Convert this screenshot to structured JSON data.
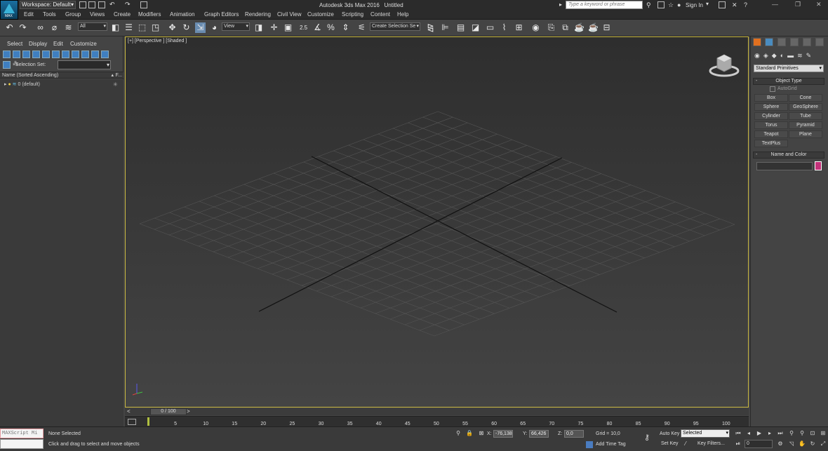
{
  "app": {
    "title": "Autodesk 3ds Max 2016",
    "doc": "Untitled",
    "logo_text": "MAX"
  },
  "titlebar": {
    "workspace": "Workspace: Default",
    "search_placeholder": "Type a keyword or phrase",
    "sign_in": "Sign In"
  },
  "menu": [
    "Edit",
    "Tools",
    "Group",
    "Views",
    "Create",
    "Modifiers",
    "Animation",
    "Graph Editors",
    "Rendering",
    "Civil View",
    "Customize",
    "Scripting",
    "Content",
    "Help"
  ],
  "toolbar": {
    "filter": "All",
    "ref_coord": "View",
    "snap_value": "2.5",
    "named_set": "Create Selection Se"
  },
  "scene_explorer": {
    "tabs": [
      "Select",
      "Display",
      "Edit",
      "Customize"
    ],
    "selection_set_label": "Selection Set:",
    "column_header": "Name (Sorted Ascending)",
    "column_flag": "F...",
    "rows": [
      "0 (default)"
    ]
  },
  "viewport": {
    "label": "[+] [Perspective ] [Shaded ]"
  },
  "time": {
    "slider": "0 / 100",
    "ticks": [
      "5",
      "10",
      "15",
      "20",
      "25",
      "30",
      "35",
      "40",
      "45",
      "50",
      "55",
      "60",
      "65",
      "70",
      "75",
      "80",
      "85",
      "90",
      "95",
      "100"
    ]
  },
  "command_panel": {
    "category": "Standard Primitives",
    "object_type_header": "Object Type",
    "autogrid": "AutoGrid",
    "objects": [
      "Box",
      "Cone",
      "Sphere",
      "GeoSphere",
      "Cylinder",
      "Tube",
      "Torus",
      "Pyramid",
      "Teapot",
      "Plane",
      "TextPlus"
    ],
    "name_color_header": "Name and Color",
    "object_color": "#c4327a"
  },
  "status": {
    "maxscript": "MAXScript Mi",
    "selection": "None Selected",
    "prompt": "Click and drag to select and move objects",
    "x_label": "X:",
    "x": "-76,138",
    "y_label": "Y:",
    "y": "66,426",
    "z_label": "Z:",
    "z": "0,0",
    "grid": "Grid = 10,0",
    "add_time_tag": "Add Time Tag",
    "auto_key": "Auto Key",
    "set_key": "Set Key",
    "key_mode": "Selected",
    "key_filters": "Key Filters...",
    "frame": "0"
  },
  "colors": {
    "viewport_border": "#c9b840",
    "accent": "#3f7fc0"
  }
}
